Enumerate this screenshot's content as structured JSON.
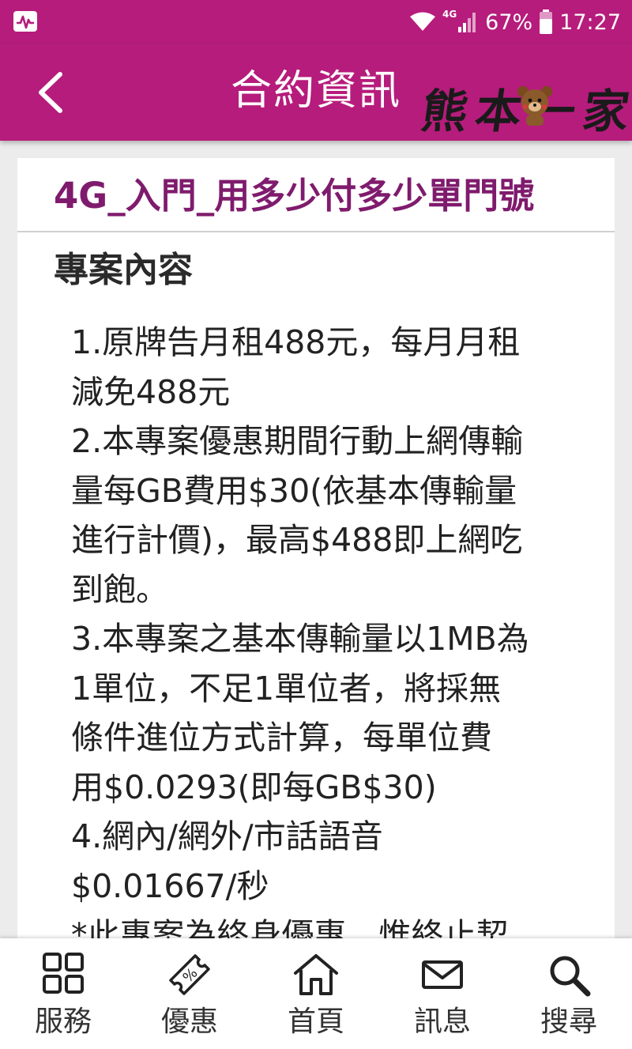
{
  "status_bar": {
    "network": "4G",
    "battery": "67%",
    "time": "17:27",
    "icons": [
      "activity-monitor-icon",
      "wifi-icon",
      "cell-signal-icon",
      "battery-icon"
    ]
  },
  "header": {
    "title": "合約資訊",
    "back_icon": "chevron-left-icon",
    "logo_text": "熊本一家",
    "colors": {
      "bar": "#b61c7c",
      "title": "#ffffff"
    }
  },
  "plan": {
    "name": "4G_入門_用多少付多少單門號",
    "name_color": "#7f1b6d",
    "section_heading": "專案內容",
    "lines": [
      "1.原牌告月租488元，每月月租",
      "減免488元",
      "2.本專案優惠期間行動上網傳輸",
      "量每GB費用$30(依基本傳輸量",
      "進行計價)，最高$488即上網吃",
      "到飽。",
      "3.本專案之基本傳輸量以1MB為",
      "1單位，不足1單位者，將採無",
      "條件進位方式計算，每單位費",
      "用$0.0293(即每GB$30)",
      "4.網內/網外/市話語音",
      "$0.01667/秒",
      "*此專案為終身優惠，惟終止契"
    ]
  },
  "bottom_nav": {
    "items": [
      {
        "label": "服務",
        "icon": "grid-icon"
      },
      {
        "label": "優惠",
        "icon": "coupon-icon"
      },
      {
        "label": "首頁",
        "icon": "home-icon"
      },
      {
        "label": "訊息",
        "icon": "mail-icon"
      },
      {
        "label": "搜尋",
        "icon": "search-icon"
      }
    ]
  }
}
